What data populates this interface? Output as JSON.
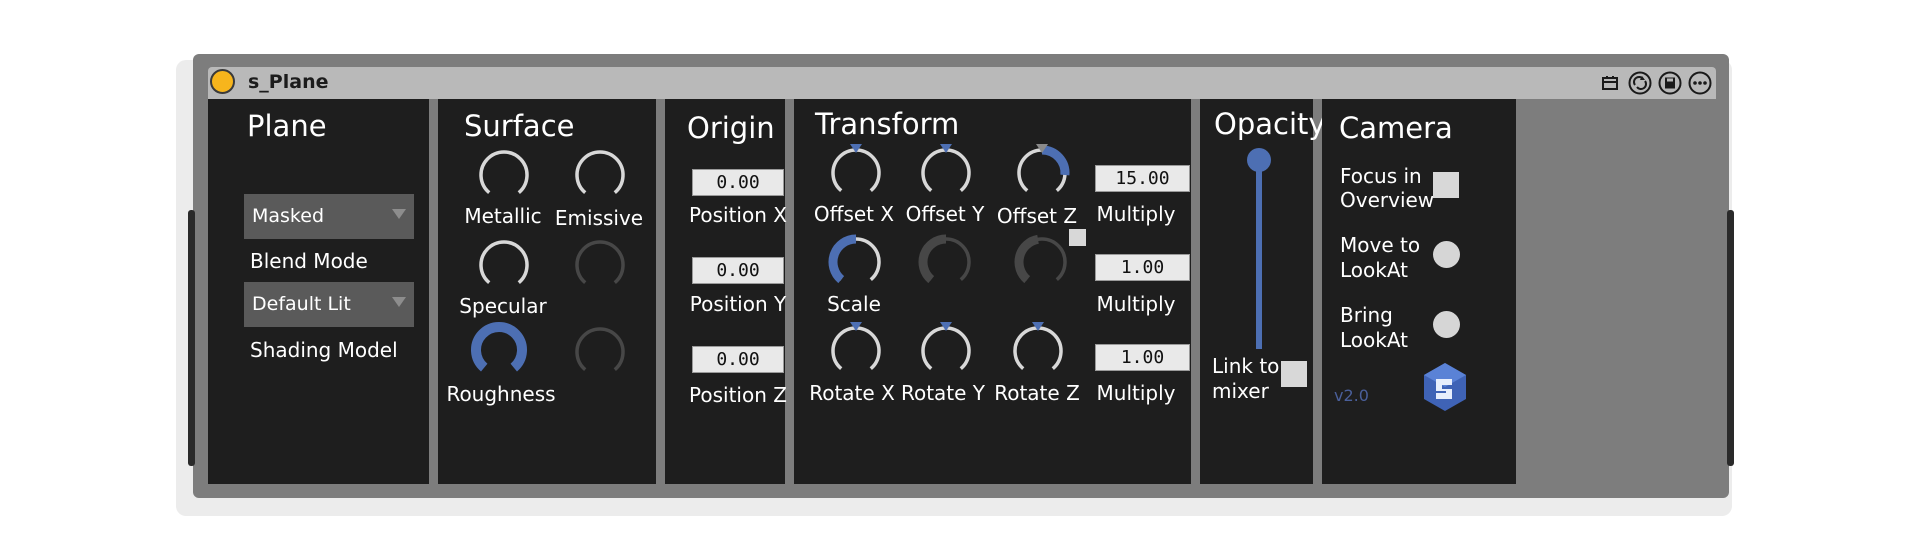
{
  "device": {
    "title": "s_Plane",
    "titlebar_icons": [
      "calendar-icon",
      "hotswap-icon",
      "save-icon",
      "more-icon"
    ]
  },
  "plane": {
    "title": "Plane",
    "blend_mode": {
      "value": "Masked",
      "label": "Blend Mode"
    },
    "shading_model": {
      "value": "Default Lit",
      "label": "Shading Model"
    }
  },
  "surface": {
    "title": "Surface",
    "metallic": "Metallic",
    "emissive": "Emissive",
    "specular": "Specular",
    "roughness": "Roughness"
  },
  "origin": {
    "title": "Origin",
    "position_x": {
      "value": "0.00",
      "label": "Position X"
    },
    "position_y": {
      "value": "0.00",
      "label": "Position Y"
    },
    "position_z": {
      "value": "0.00",
      "label": "Position Z"
    }
  },
  "transform": {
    "title": "Transform",
    "offset_x": "Offset X",
    "offset_y": "Offset Y",
    "offset_z": "Offset Z",
    "scale": "Scale",
    "rotate_x": "Rotate X",
    "rotate_y": "Rotate Y",
    "rotate_z": "Rotate Z",
    "multiply_1": {
      "value": "15.00",
      "label": "Multiply"
    },
    "multiply_2": {
      "value": "1.00",
      "label": "Multiply"
    },
    "multiply_3": {
      "value": "1.00",
      "label": "Multiply"
    }
  },
  "opacity": {
    "title": "Opacity",
    "level": 1.0,
    "link_line1": "Link to",
    "link_line2": "mixer"
  },
  "camera": {
    "title": "Camera",
    "focus_line1": "Focus in",
    "focus_line2": "Overview",
    "move_line1": "Move to",
    "move_line2": "LookAt",
    "bring_line1": "Bring",
    "bring_line2": "LookAt",
    "version": "v2.0"
  },
  "colors": {
    "accent": "#4d6fb3",
    "panel": "#1e1e1e",
    "knob_ring": "#d8d8d8",
    "knob_disabled": "#474747"
  }
}
